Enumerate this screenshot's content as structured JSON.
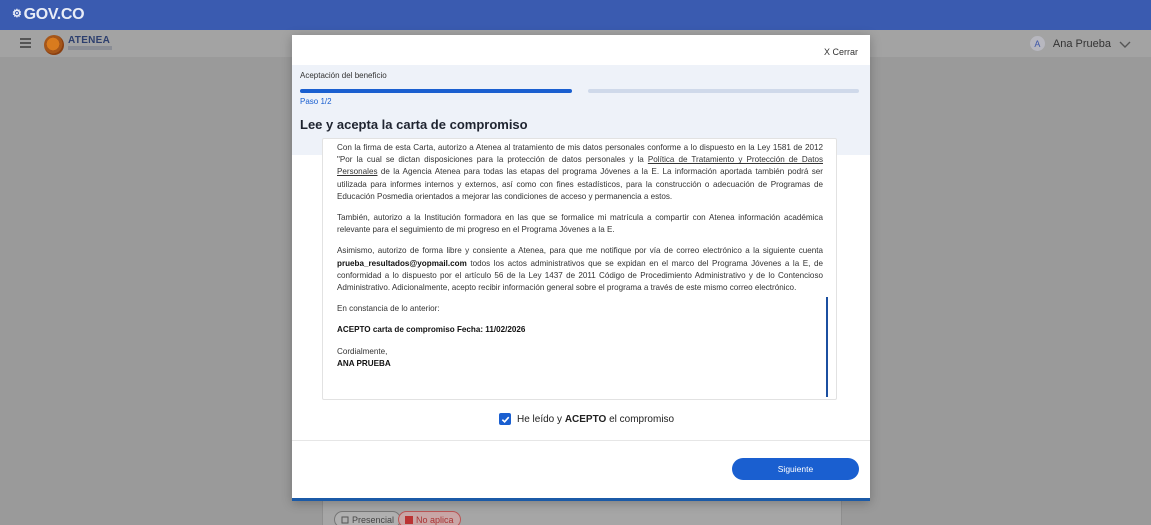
{
  "gov_bar": {
    "logo_text": "GOV.CO"
  },
  "app_header": {
    "logo_text": "ATENEA",
    "user": {
      "initial": "A",
      "name": "Ana Prueba"
    }
  },
  "background_page": {
    "chips": [
      {
        "label": "Presencial"
      },
      {
        "label": "No aplica"
      }
    ]
  },
  "modal": {
    "close_label": "X Cerrar",
    "step_title": "Aceptación del beneficio",
    "progress": {
      "current_step": 1,
      "total_steps": 2
    },
    "step_indicator": "Paso 1/2",
    "heading": "Lee y acepta la carta de compromiso",
    "letter": {
      "p1_a": "Con la firma de esta Carta, autorizo a Atenea al tratamiento de mis datos personales conforme a lo dispuesto en la Ley 1581 de 2012 \"Por la cual se dictan disposiciones para la protección de datos personales y la ",
      "p1_link": "Política de Tratamiento y Protección de Datos Personales",
      "p1_b": " de la Agencia Atenea para todas las etapas del programa Jóvenes a la E. La información aportada también podrá ser utilizada para informes internos y externos, así como con fines estadísticos, para la construcción o adecuación de Programas de Educación Posmedia orientados a mejorar las condiciones de acceso y permanencia a estos.",
      "p2": "También, autorizo a la Institución formadora en las que se formalice mi matrícula a compartir con Atenea información académica relevante para el seguimiento de mi progreso en el Programa Jóvenes a la E.",
      "p3_a": "Asimismo, autorizo de forma libre y consiente a Atenea, para que me notifique por vía de correo electrónico a la siguiente cuenta ",
      "p3_email": "prueba_resultados@yopmail.com",
      "p3_b": " todos los actos administrativos que se expidan en el marco del Programa Jóvenes a la E, de conformidad a lo dispuesto por el artículo 56 de la Ley 1437 de 2011 Código de Procedimiento Administrativo y de lo Contencioso Administrativo. Adicionalmente, acepto recibir información general sobre el programa a través de este mismo correo electrónico.",
      "p4": "En constancia de lo anterior:",
      "p5": "ACEPTO carta de compromiso Fecha: 11/02/2026",
      "p6": "Cordialmente,",
      "p7": "ANA PRUEBA"
    },
    "accept": {
      "checked": true,
      "pre": "He leído y ",
      "bold": "ACEPTO",
      "post": " el compromiso"
    },
    "next_button": "Siguiente"
  },
  "colors": {
    "gov_blue": "#3a5bb0",
    "primary": "#1a5fd0",
    "overlay": "#9a9a9a"
  }
}
